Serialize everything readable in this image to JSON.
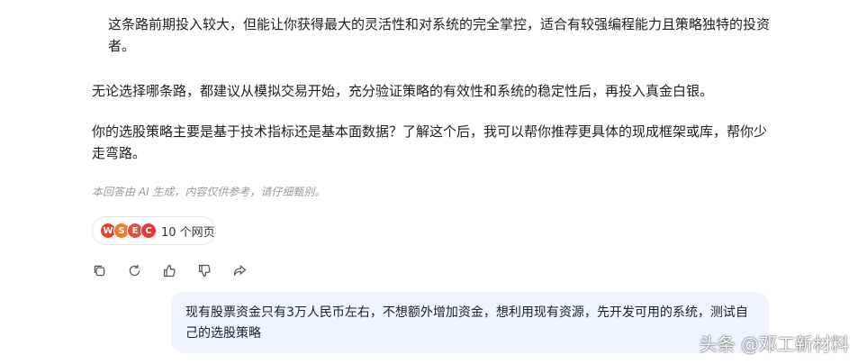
{
  "messages": {
    "p1": "这条路前期投入较大，但能让你获得最大的灵活性和对系统的完全掌控，适合有较强编程能力且策略独特的投资者。",
    "p2": "无论选择哪条路，都建议从模拟交易开始，充分验证策略的有效性和系统的稳定性后，再投入真金白银。",
    "p3": "你的选股策略主要是基于技术指标还是基本面数据？了解这个后，我可以帮你推荐更具体的现成框架或库，帮你少走弯路。",
    "disclaimer": "本回答由 AI 生成，内容仅供参考，请仔细甄别。"
  },
  "sources": {
    "label": "10 个网页",
    "icons": [
      {
        "name": "source-icon-1",
        "color": "#e8422e",
        "glyph": "W"
      },
      {
        "name": "source-icon-2",
        "color": "#f07b2a",
        "glyph": "S"
      },
      {
        "name": "source-icon-3",
        "color": "#e84c3d",
        "glyph": "E"
      },
      {
        "name": "source-icon-4",
        "color": "#e53935",
        "glyph": "C"
      }
    ]
  },
  "actions": [
    "copy-icon",
    "regenerate-icon",
    "thumbs-up-icon",
    "thumbs-down-icon",
    "share-icon"
  ],
  "user_message": "现有股票资金只有3万人民币左右，不想额外增加资金，想利用现有资源，先开发可用的系统，测试自己的选股策略",
  "watermark": "头条 @邓工新材料",
  "colors": {
    "bubble": "#eff4ff",
    "disclaimer": "#9a9a9a"
  }
}
